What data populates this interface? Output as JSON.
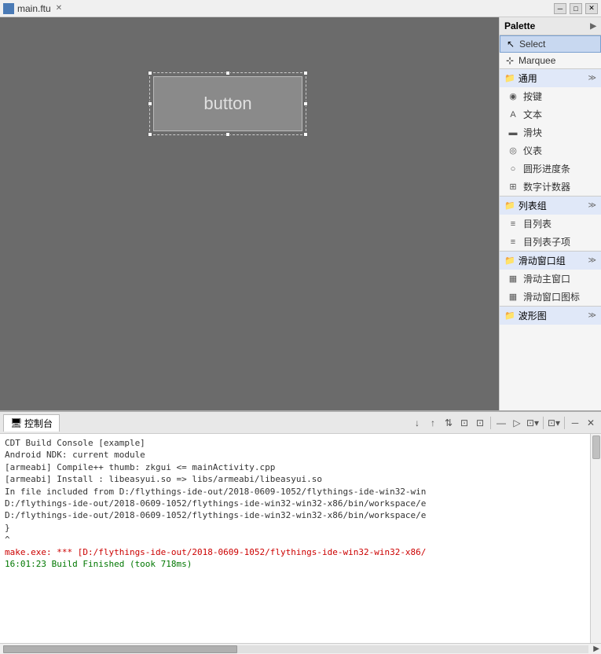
{
  "titlebar": {
    "title": "main.ftu",
    "close_label": "✕",
    "controls": [
      "─",
      "□",
      "✕"
    ]
  },
  "canvas": {
    "widget_text": "button"
  },
  "palette": {
    "header_label": "Palette",
    "header_arrow": "▶",
    "tools": [
      {
        "id": "select",
        "label": "Select",
        "icon": "↖"
      },
      {
        "id": "marquee",
        "label": "Marquee",
        "icon": "⊹"
      }
    ],
    "sections": [
      {
        "id": "general",
        "label": "通用",
        "icon": "📁",
        "expand_icon": "≫",
        "items": [
          {
            "id": "button",
            "label": "按键",
            "icon": "◉"
          },
          {
            "id": "text",
            "label": "文本",
            "icon": "A"
          },
          {
            "id": "slider",
            "label": "滑块",
            "icon": "▬"
          },
          {
            "id": "gauge",
            "label": "仪表",
            "icon": "◎"
          },
          {
            "id": "circular-progress",
            "label": "圆形进度条",
            "icon": "○"
          },
          {
            "id": "counter",
            "label": "数字计数器",
            "icon": "⊞"
          }
        ]
      },
      {
        "id": "list-group",
        "label": "列表组",
        "icon": "📁",
        "expand_icon": "≫",
        "items": [
          {
            "id": "list",
            "label": "目列表",
            "icon": "≡"
          },
          {
            "id": "list-item",
            "label": "目列表子项",
            "icon": "≡"
          }
        ]
      },
      {
        "id": "scroll-group",
        "label": "滑动窗口组",
        "icon": "📁",
        "expand_icon": "≫",
        "items": [
          {
            "id": "scroll-window",
            "label": "滑动主窗口",
            "icon": "▦"
          },
          {
            "id": "scroll-icon",
            "label": "滑动窗口图标",
            "icon": "▦"
          }
        ]
      },
      {
        "id": "waveform",
        "label": "波形图",
        "icon": "📁",
        "expand_icon": "≫",
        "items": []
      }
    ]
  },
  "console": {
    "tab_label": "控制台",
    "toolbar_buttons": [
      "↓",
      "↑",
      "⇅",
      "⊡",
      "⊡",
      "—",
      "⊡",
      "▷",
      "⊡",
      "▾",
      "⊡",
      "▾",
      "─",
      "✕"
    ],
    "header_line": "CDT Build Console [example]",
    "lines": [
      {
        "type": "normal",
        "text": "Android NDK:    current module"
      },
      {
        "type": "normal",
        "text": "[armeabi] Compile++ thumb: zkgui <= mainActivity.cpp"
      },
      {
        "type": "normal",
        "text": "[armeabi] Install       : libeasyui.so => libs/armeabi/libeasyui.so"
      },
      {
        "type": "normal",
        "text": "In file included from D:/flythings-ide-out/2018-0609-1052/flythings-ide-win32-win"
      },
      {
        "type": "normal",
        "text": "D:/flythings-ide-out/2018-0609-1052/flythings-ide-win32-win32-x86/bin/workspace/e"
      },
      {
        "type": "normal",
        "text": "D:/flythings-ide-out/2018-0609-1052/flythings-ide-win32-win32-x86/bin/workspace/e"
      },
      {
        "type": "normal",
        "text": "  }"
      },
      {
        "type": "normal",
        "text": "^"
      },
      {
        "type": "error",
        "text": "make.exe: *** [D:/flythings-ide-out/2018-0609-1052/flythings-ide-win32-win32-x86/"
      },
      {
        "type": "normal",
        "text": ""
      },
      {
        "type": "success",
        "text": "16:01:23 Build Finished (took 718ms)"
      }
    ]
  }
}
